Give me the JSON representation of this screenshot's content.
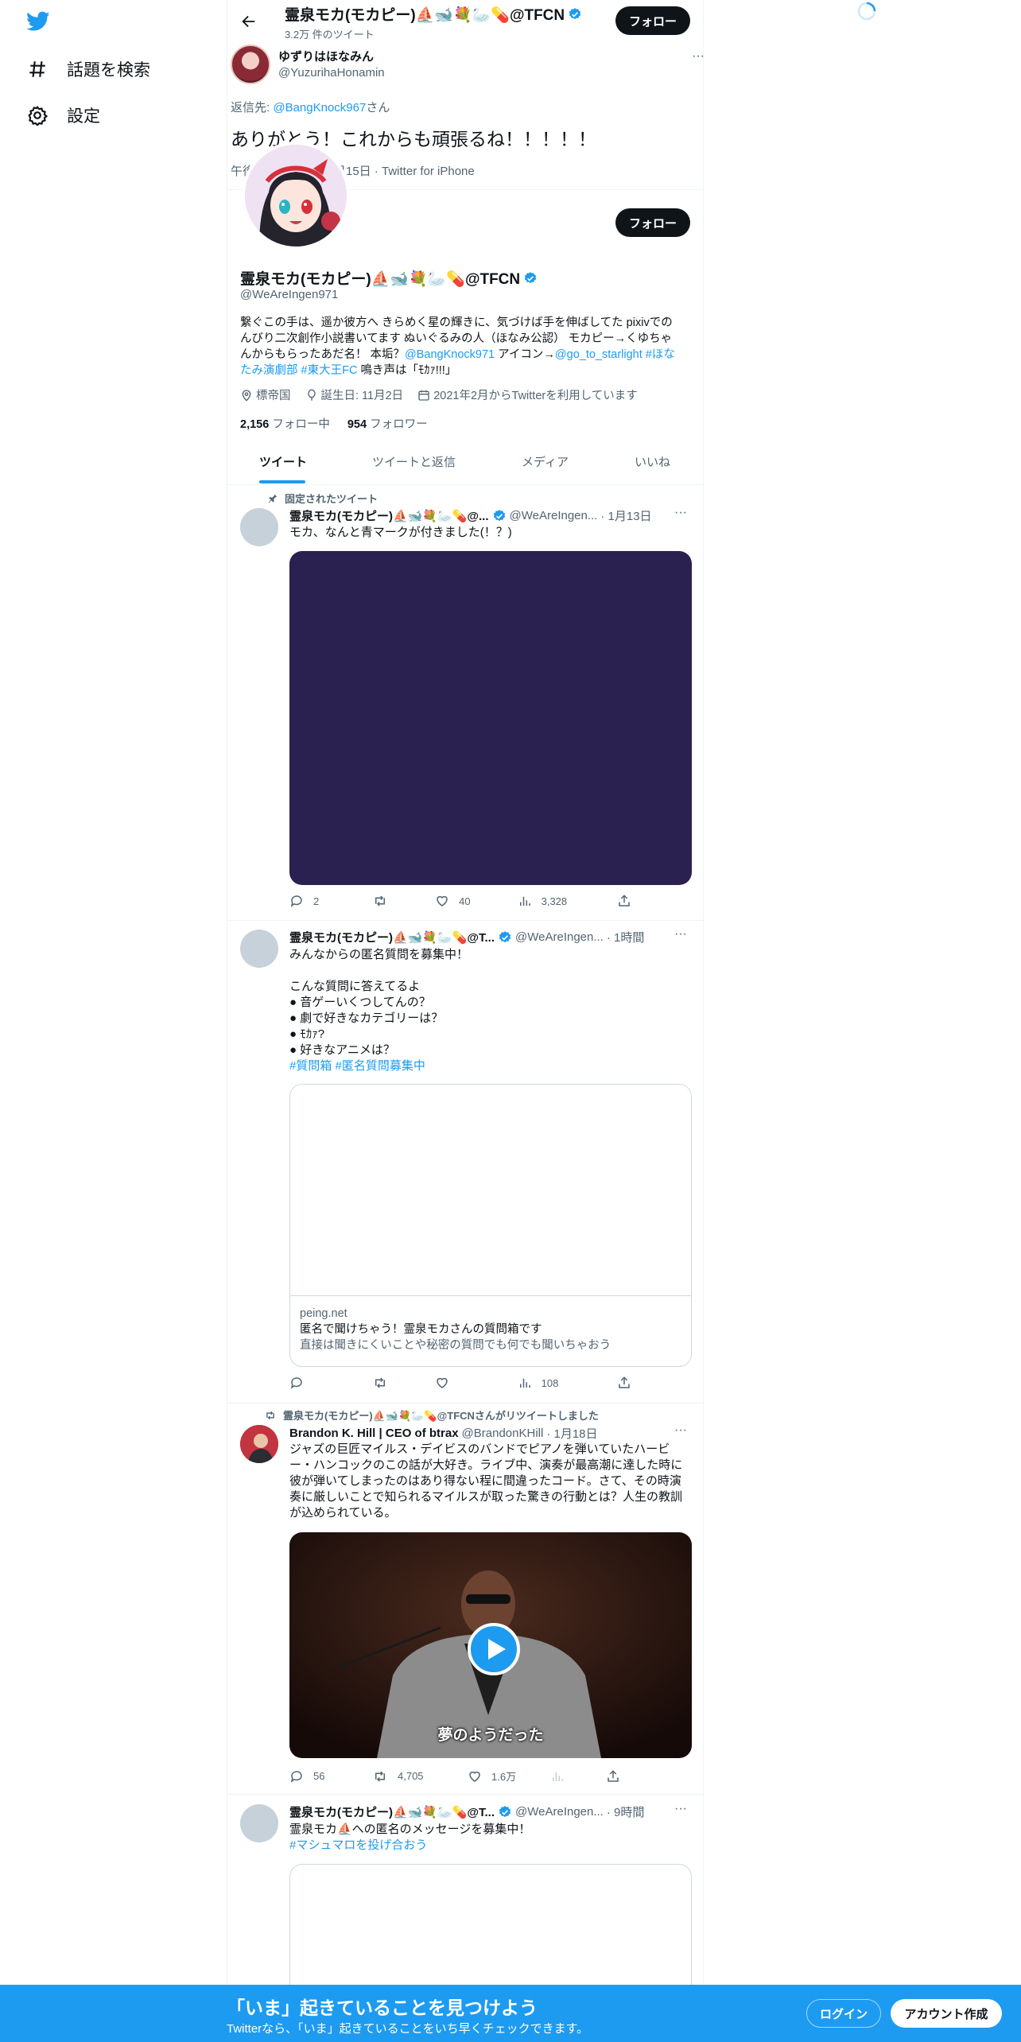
{
  "nav": {
    "explore_label": "話題を検索",
    "settings_label": "設定"
  },
  "header": {
    "title": "霊泉モカ(モカピー)⛵🐋💐🦢💊@TFCN",
    "tweet_count": "3.2万 件のツイート",
    "follow_label": "フォロー"
  },
  "reply_tweet": {
    "name": "ゆずりはほなみん",
    "handle": "@YuzurihaHonamin",
    "reply_prefix": "返信先: ",
    "reply_to": "@BangKnock967",
    "reply_suffix": "さん",
    "text": "ありがとう！これからも頑張るね！！！！！",
    "meta_left": "午後",
    "meta_right": "月15日 · Twitter for iPhone"
  },
  "profile": {
    "name": "霊泉モカ(モカピー)⛵🐋💐🦢💊@TFCN",
    "handle": "@WeAreIngen971",
    "follow_label": "フォロー",
    "bio_1": "繋ぐこの手は、遥か彼方へ きらめく星の輝きに、気づけば手を伸ばしてた pixivでの",
    "bio_2": "んびり二次創作小説書いてます ぬいぐるみの人（ほなみ公認） モカピー→くゆちゃ",
    "bio_3a": "んからもらったあだ名！ 本垢？",
    "bio_3_link1": "@BangKnock971",
    "bio_3b": " アイコン→",
    "bio_3_link2": "@go_to_starlight",
    "bio_3_tag": " #ほな",
    "bio_4_tag1": "たみ演劇部",
    "bio_4_tag2": " #東大王FC",
    "bio_4b": " 鳴き声は「ﾓｶｧ!!!」",
    "location": "標帝国",
    "birthday": "誕生日: 11月2日",
    "joined": "2021年2月からTwitterを利用しています",
    "following_count": "2,156",
    "following_label": " フォロー中",
    "followers_count": "954",
    "followers_label": " フォロワー"
  },
  "tabs": [
    "ツイート",
    "ツイートと返信",
    "メディア",
    "いいね"
  ],
  "tweets": [
    {
      "pinned_label": "固定されたツイート",
      "name": "霊泉モカ(モカピー)⛵🐋💐🦢💊@...",
      "handle": "@WeAreIngen...",
      "time": "· 1月13日",
      "text": "モカ、なんと青マークが付きました(！？)",
      "replies": "2",
      "retweets": "",
      "likes": "40",
      "views": "3,328",
      "media_color": "#2b2150"
    },
    {
      "name": "霊泉モカ(モカピー)⛵🐋💐🦢💊@T...",
      "handle": "@WeAreIngen...",
      "time": "· 1時間",
      "lines": [
        "みんなからの匿名質問を募集中！",
        "",
        "こんな質問に答えてるよ",
        "● 音ゲーいくつしてんの？",
        "● 劇で好きなカテゴリーは？",
        "● ﾓｶｧ?",
        "● 好きなアニメは？"
      ],
      "tags": "#質問箱 #匿名質問募集中",
      "card_domain": "peing.net",
      "card_title": "匿名で聞けちゃう！霊泉モカさんの質問箱です",
      "card_desc": "直接は聞きにくいことや秘密の質問でも何でも聞いちゃおう",
      "views": "108"
    },
    {
      "retweeted_by": "霊泉モカ(モカピー)⛵🐋💐🦢💊@TFCNさんがリツイートしました",
      "name": "Brandon K. Hill | CEO of btrax",
      "handle": "@BrandonKHill",
      "time": "· 1月18日",
      "lines": [
        "ジャズの巨匠マイルス・デイビスのバンドでピアノを弾いていたハービ",
        "ー・ハンコックのこの話が大好き。ライブ中、演奏が最高潮に達した時に",
        "彼が弾いてしまったのはあり得ない程に間違ったコード。さて、その時演",
        "奏に厳しいことで知られるマイルスが取った驚きの行動とは？人生の教訓",
        "が込められている。"
      ],
      "video_caption": "夢のようだった",
      "replies": "56",
      "retweets": "4,705",
      "likes": "1.6万"
    },
    {
      "name": "霊泉モカ(モカピー)⛵🐋💐🦢💊@T...",
      "handle": "@WeAreIngen...",
      "time": "· 9時間",
      "text": "霊泉モカ⛵への匿名のメッセージを募集中！",
      "tags": "#マシュマロを投げ合おう"
    }
  ],
  "bottom_bar": {
    "headline": "「いま」起きていることを見つけよう",
    "subtext": "Twitterなら、「いま」起きていることをいち早くチェックできます。",
    "login_label": "ログイン",
    "signup_label": "アカウント作成"
  },
  "colors": {
    "accent": "#1d9bf0",
    "text": "#0f1419",
    "secondary": "#536471"
  }
}
